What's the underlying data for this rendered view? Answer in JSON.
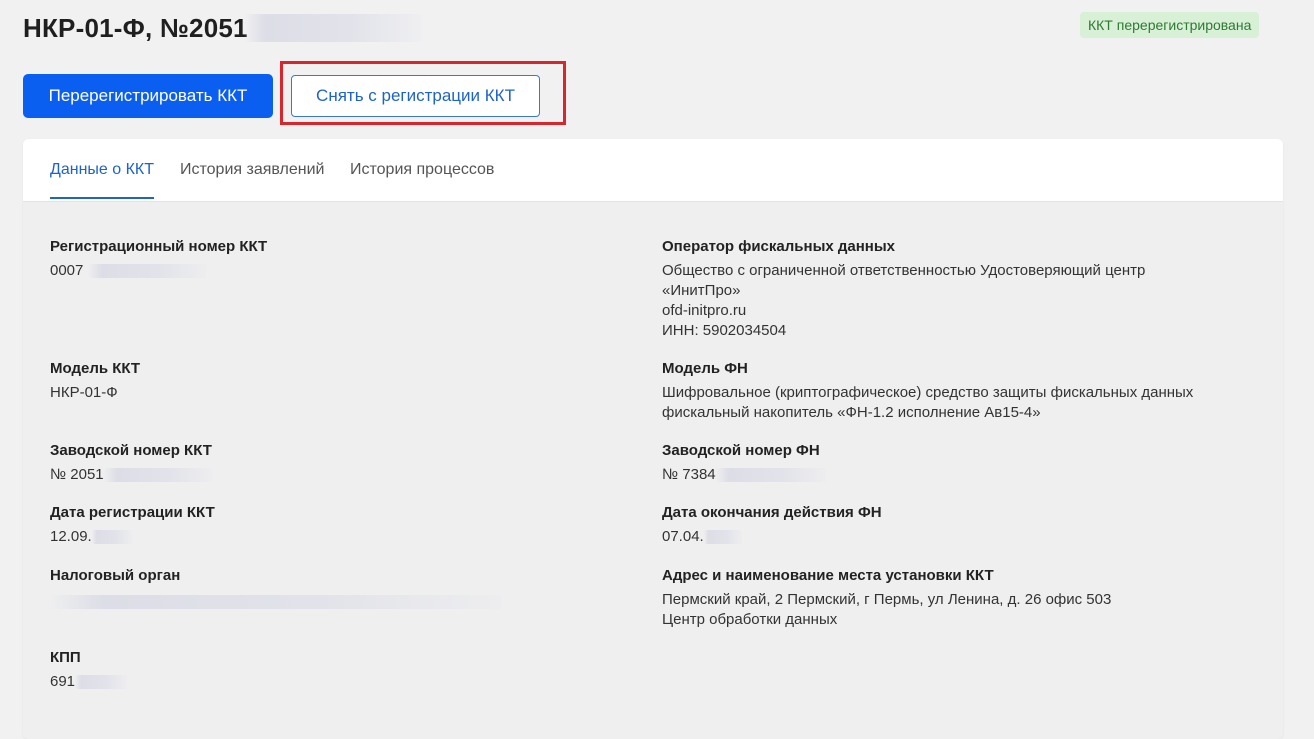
{
  "header": {
    "title": "НКР-01-Ф, №2051",
    "status_badge": "ККТ перерегистрирована"
  },
  "actions": {
    "reregister_label": "Перерегистрировать ККТ",
    "deregister_label": "Снять с регистрации ККТ"
  },
  "tabs": [
    {
      "label": "Данные о ККТ",
      "active": true
    },
    {
      "label": "История заявлений",
      "active": false
    },
    {
      "label": "История процессов",
      "active": false
    }
  ],
  "left_fields": {
    "reg_number": {
      "label": "Регистрационный номер ККТ",
      "value": "0007"
    },
    "model": {
      "label": "Модель ККТ",
      "value": "НКР-01-Ф"
    },
    "serial": {
      "label": "Заводской номер ККТ",
      "value": "№ 2051"
    },
    "reg_date": {
      "label": "Дата регистрации ККТ",
      "value": "12.09."
    },
    "tax_office": {
      "label": "Налоговый орган",
      "value": ""
    },
    "kpp": {
      "label": "КПП",
      "value": "691"
    }
  },
  "right_fields": {
    "ofd": {
      "label": "Оператор фискальных данных",
      "line1": "Общество с ограниченной ответственностью Удостоверяющий центр",
      "line2": "«ИнитПро»",
      "line3": "ofd-initpro.ru",
      "line4": "ИНН: 5902034504"
    },
    "fn_model": {
      "label": "Модель ФН",
      "line1": "Шифровальное (криптографическое) средство защиты фискальных данных",
      "line2": "фискальный накопитель «ФН-1.2 исполнение Ав15-4»"
    },
    "fn_serial": {
      "label": "Заводской номер ФН",
      "value": "№ 7384"
    },
    "fn_expiry": {
      "label": "Дата окончания действия ФН",
      "value": "07.04."
    },
    "address": {
      "label": "Адрес и наименование места установки ККТ",
      "line1": "Пермский край, 2 Пермский, г Пермь, ул Ленина, д. 26 офис 503",
      "line2": "Центр обработки данных"
    }
  }
}
